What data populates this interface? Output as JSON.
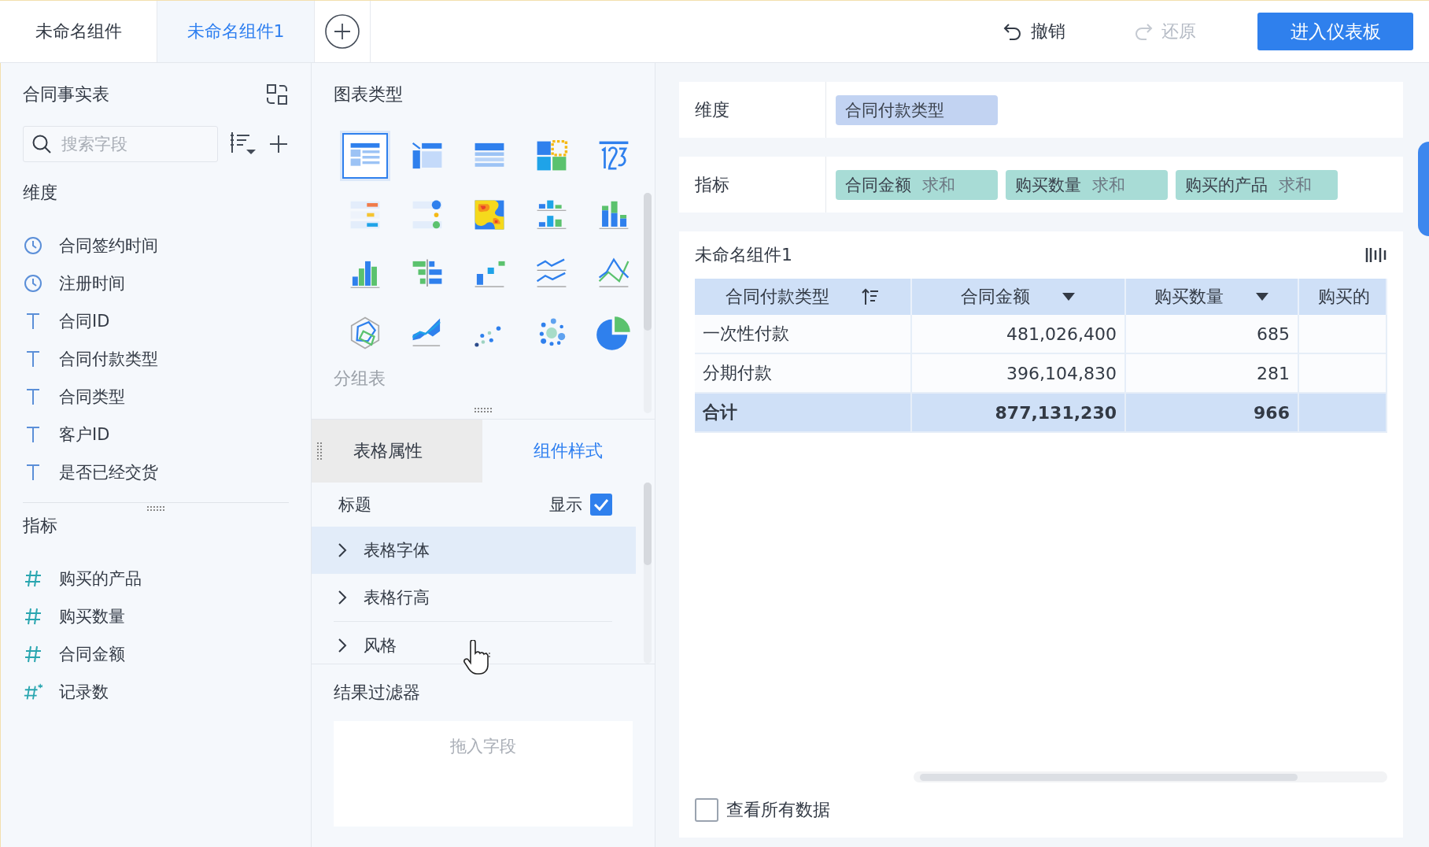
{
  "tabs": [
    {
      "label": "未命名组件",
      "selected": false
    },
    {
      "label": "未命名组件1",
      "selected": true
    }
  ],
  "toolbar": {
    "undo": "撤销",
    "redo": "还原",
    "redo_disabled": true,
    "primary": "进入仪表板"
  },
  "field_panel": {
    "title": "合同事实表",
    "search": {
      "placeholder": "搜索字段"
    },
    "dimensions": {
      "title": "维度",
      "fields": [
        {
          "label": "合同签约时间",
          "kind": "time"
        },
        {
          "label": "注册时间",
          "kind": "time"
        },
        {
          "label": "合同ID",
          "kind": "text"
        },
        {
          "label": "合同付款类型",
          "kind": "text"
        },
        {
          "label": "合同类型",
          "kind": "text"
        },
        {
          "label": "客户ID",
          "kind": "text"
        },
        {
          "label": "是否已经交货",
          "kind": "text"
        }
      ]
    },
    "measures": {
      "title": "指标",
      "fields": [
        {
          "label": "购买的产品",
          "kind": "number"
        },
        {
          "label": "购买数量",
          "kind": "number"
        },
        {
          "label": "合同金额",
          "kind": "number"
        },
        {
          "label": "记录数",
          "kind": "count"
        }
      ]
    }
  },
  "chart_types": {
    "title": "图表类型",
    "caption": "分组表",
    "items": [
      {
        "kind": "group-table",
        "selected": true
      },
      {
        "kind": "cross-table",
        "selected": false
      },
      {
        "kind": "detail-table",
        "selected": false
      },
      {
        "kind": "color-grid",
        "selected": false
      },
      {
        "kind": "number",
        "selected": false
      },
      {
        "kind": "kpi-list",
        "selected": false
      },
      {
        "kind": "dot-list",
        "selected": false
      },
      {
        "kind": "heatmap",
        "selected": false
      },
      {
        "kind": "grouped-bar",
        "selected": false
      },
      {
        "kind": "stacked-bar",
        "selected": false
      },
      {
        "kind": "bar",
        "selected": false
      },
      {
        "kind": "diverging-bar",
        "selected": false
      },
      {
        "kind": "step",
        "selected": false
      },
      {
        "kind": "multi-line",
        "selected": false
      },
      {
        "kind": "combo-line",
        "selected": false
      },
      {
        "kind": "radar",
        "selected": false
      },
      {
        "kind": "area",
        "selected": false
      },
      {
        "kind": "scatter",
        "selected": false
      },
      {
        "kind": "bubble",
        "selected": false
      },
      {
        "kind": "pie",
        "selected": false
      }
    ]
  },
  "property_tabs": [
    {
      "label": "表格属性",
      "selected": false
    },
    {
      "label": "组件样式",
      "selected": true
    }
  ],
  "style_settings": {
    "title_row": {
      "label": "标题",
      "toggle_label": "显示",
      "checked": true
    },
    "sections": [
      {
        "label": "表格字体",
        "expanded": false,
        "hovered": true
      },
      {
        "label": "表格行高",
        "expanded": false,
        "hovered": false
      },
      {
        "label": "风格",
        "expanded": false,
        "hovered": false
      }
    ]
  },
  "result_filter": {
    "title": "结果过滤器",
    "placeholder": "拖入字段"
  },
  "shelves": {
    "dimension": {
      "label": "维度",
      "pills": [
        {
          "field": "合同付款类型"
        }
      ]
    },
    "measure": {
      "label": "指标",
      "pills": [
        {
          "field": "合同金额",
          "aggregate": "求和"
        },
        {
          "field": "购买数量",
          "aggregate": "求和"
        },
        {
          "field": "购买的产品",
          "aggregate": "求和"
        }
      ]
    }
  },
  "widget": {
    "title": "未命名组件1",
    "table": {
      "columns": [
        {
          "label": "合同付款类型",
          "kind": "dimension",
          "partial": false
        },
        {
          "label": "合同金额",
          "kind": "measure",
          "partial": false
        },
        {
          "label": "购买数量",
          "kind": "measure",
          "partial": false
        },
        {
          "label": "购买的",
          "kind": "measure",
          "partial": true
        }
      ],
      "rows": [
        [
          "一次性付款",
          "481,026,400",
          "685"
        ],
        [
          "分期付款",
          "396,104,830",
          "281"
        ]
      ],
      "total": [
        "合计",
        "877,131,230",
        "966"
      ]
    },
    "view_all": {
      "label": "查看所有数据",
      "checked": false
    }
  }
}
